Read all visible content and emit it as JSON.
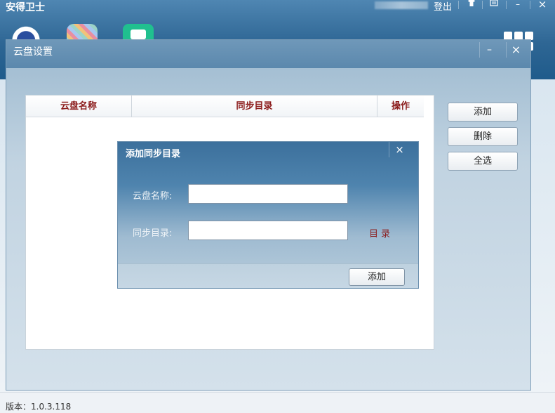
{
  "app": {
    "title": "安得卫士",
    "logout_label": "登出",
    "version_label": "版本：1.0.3.118"
  },
  "window_controls": {
    "skin_icon": "shirt-icon",
    "menu_icon": "menu-icon",
    "minimize_glyph": "–",
    "close_glyph": "×"
  },
  "cloud_dialog": {
    "title": "云盘设置",
    "minimize_glyph": "–",
    "close_glyph": "×",
    "table": {
      "columns": [
        "云盘名称",
        "同步目录",
        "操作"
      ],
      "rows": []
    },
    "buttons": {
      "add": "添加",
      "delete": "删除",
      "select_all": "全选"
    }
  },
  "add_dialog": {
    "title": "添加同步目录",
    "close_glyph": "×",
    "name_label": "云盘名称:",
    "name_value": "",
    "dir_label": "同步目录:",
    "dir_value": "",
    "dir_link": "目录",
    "add_button": "添加"
  }
}
